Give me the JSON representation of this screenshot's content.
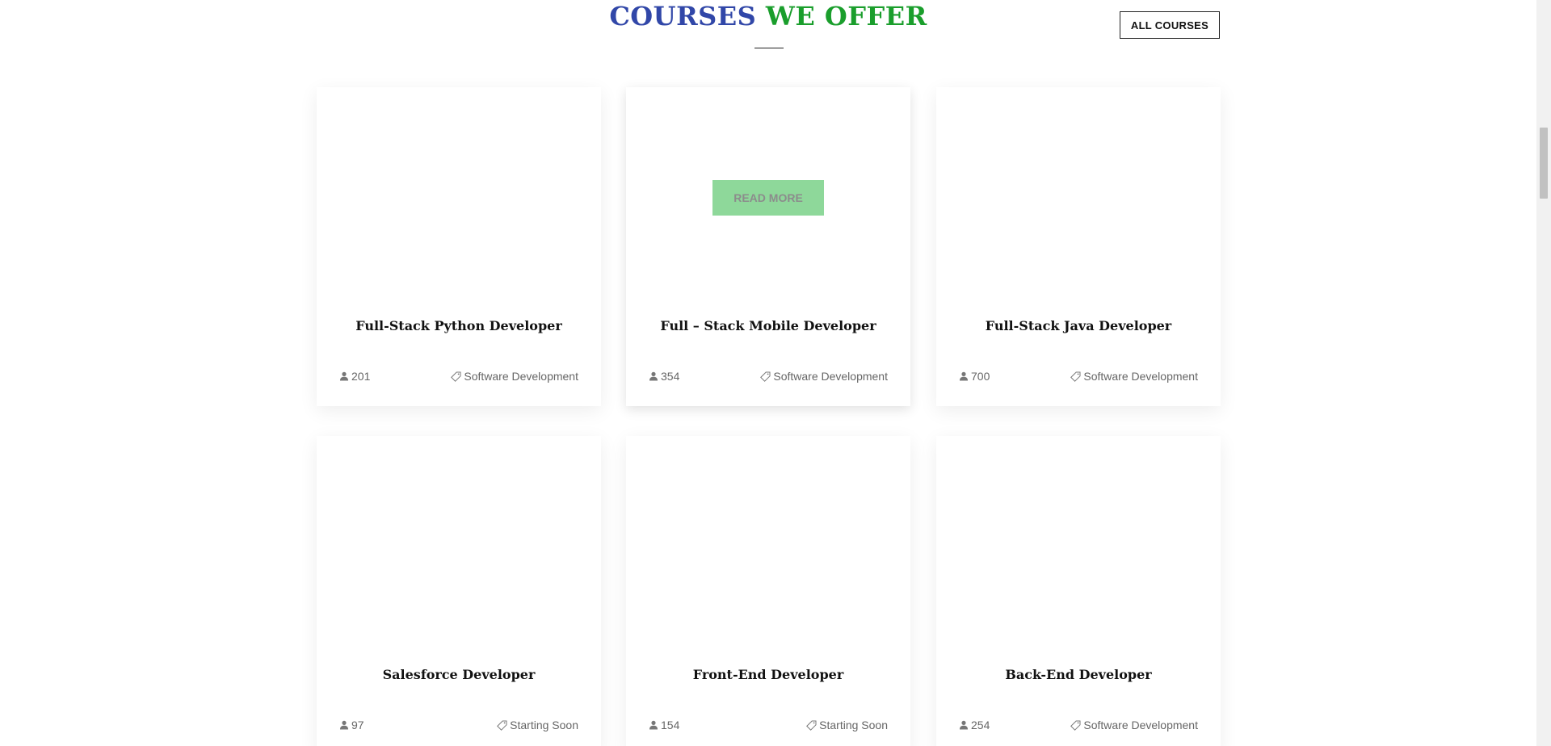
{
  "section": {
    "title_part1": "COURSES",
    "title_part2": "WE OFFER",
    "all_courses_label": "ALL COURSES"
  },
  "colors": {
    "title_blue": "#3147a8",
    "title_green": "#1a9e2c",
    "read_more_bg": "#8ed89a"
  },
  "read_more_label": "READ MORE",
  "courses": [
    {
      "title": "Full-Stack Python Developer",
      "students": "201",
      "category": "Software Development"
    },
    {
      "title": "Full – Stack Mobile Developer",
      "students": "354",
      "category": "Software Development"
    },
    {
      "title": "Full-Stack Java Developer",
      "students": "700",
      "category": "Software Development"
    },
    {
      "title": "Salesforce Developer",
      "students": "97",
      "category": "Starting Soon"
    },
    {
      "title": "Front-End Developer",
      "students": "154",
      "category": "Starting Soon"
    },
    {
      "title": "Back-End Developer",
      "students": "254",
      "category": "Software Development"
    }
  ],
  "icons": {
    "students": "user-icon",
    "category": "tag-icon"
  }
}
